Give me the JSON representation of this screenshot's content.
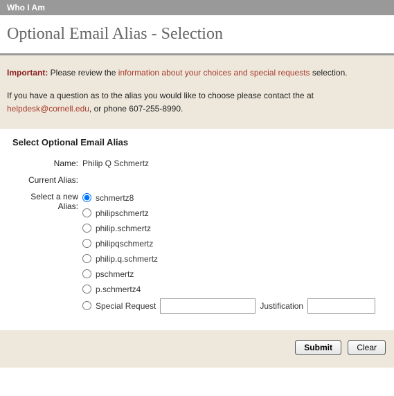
{
  "topbar": {
    "title": "Who I Am"
  },
  "page": {
    "title": "Optional Email Alias - Selection"
  },
  "info": {
    "important_label": "Important:",
    "lead_text": " Please review the ",
    "choices_link": "information about your choices and special requests",
    "after_link": " selection.",
    "question_lead": "If you have a question as to the alias you would like to choose please contact the at ",
    "helpdesk_email": "helpdesk@cornell.edu",
    "phone_tail": ", or phone 607-255-8990."
  },
  "form": {
    "heading": "Select Optional Email Alias",
    "name_label": "Name:",
    "name_value": "Philip Q Schmertz",
    "current_label": "Current Alias:",
    "current_value": "",
    "select_label_line1": "Select a new",
    "select_label_line2": "Alias:",
    "options": [
      "schmertz8",
      "philipschmertz",
      "philip.schmertz",
      "philipqschmertz",
      "philip.q.schmertz",
      "pschmertz",
      "p.schmertz4",
      "Special Request"
    ],
    "selected_index": 0,
    "justification_label": "Justification",
    "special_request_value": "",
    "justification_value": ""
  },
  "buttons": {
    "submit": "Submit",
    "clear": "Clear"
  }
}
